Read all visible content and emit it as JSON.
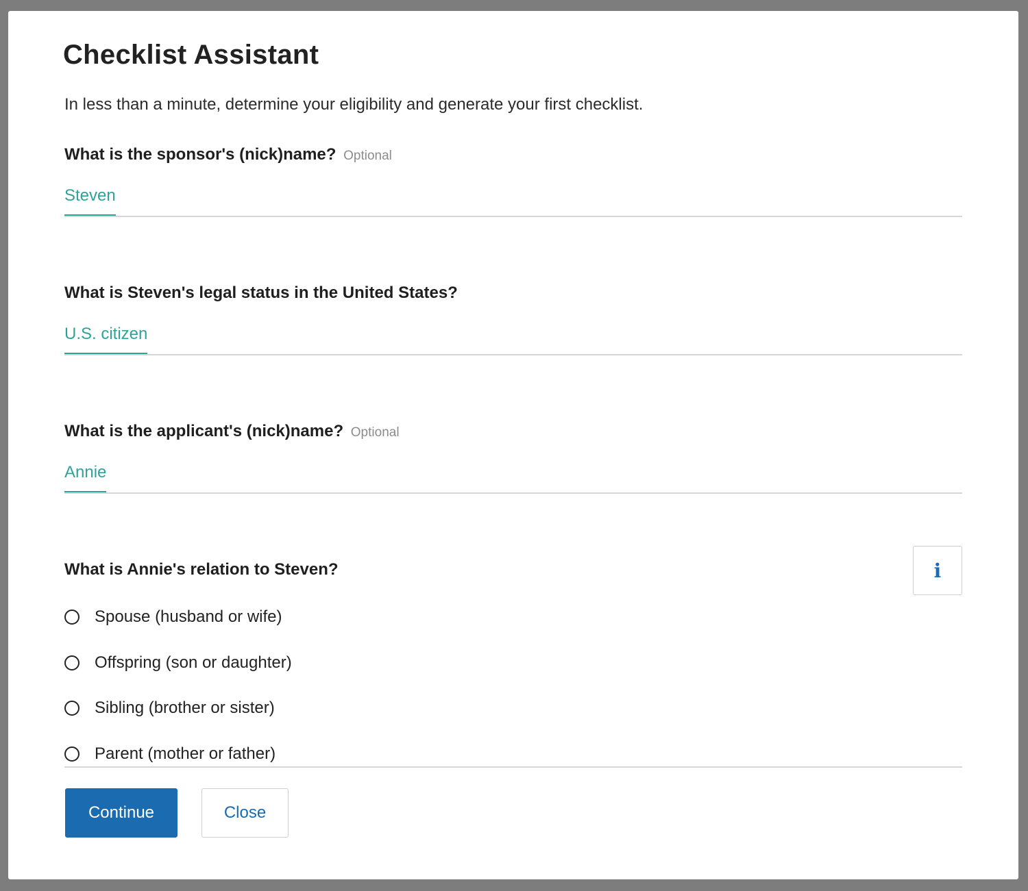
{
  "dialog": {
    "title": "Checklist Assistant",
    "intro": "In less than a minute, determine your eligibility and generate your first checklist."
  },
  "questions": [
    {
      "label": "What is the sponsor's (nick)name?",
      "optional": "Optional",
      "value": "Steven"
    },
    {
      "label": "What is Steven's legal status in the United States?",
      "value": "U.S. citizen"
    },
    {
      "label": "What is the applicant's (nick)name?",
      "optional": "Optional",
      "value": "Annie"
    },
    {
      "label": "What is Annie's relation to Steven?",
      "info_icon": "info-icon",
      "options": [
        "Spouse (husband or wife)",
        "Offspring (son or daughter)",
        "Sibling (brother or sister)",
        "Parent (mother or father)"
      ],
      "selected": null
    }
  ],
  "buttons": {
    "continue": "Continue",
    "close": "Close"
  },
  "colors": {
    "accent": "#2fa39a",
    "primary": "#1a6bb0",
    "backdrop": "#7d7d7d"
  }
}
